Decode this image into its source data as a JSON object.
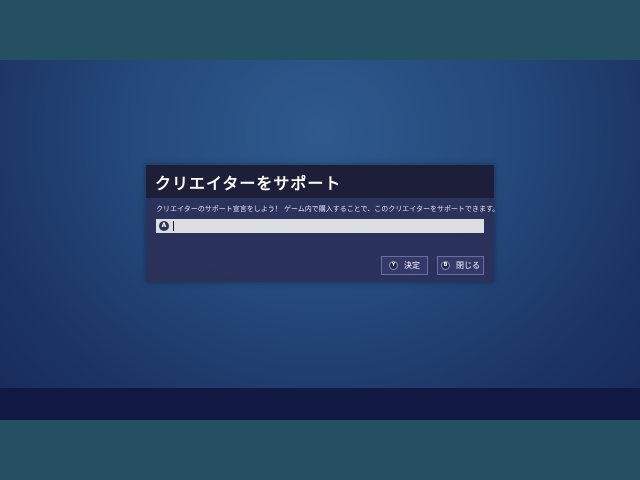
{
  "dialog": {
    "title": "クリエイターをサポート",
    "message": "クリエイターのサポート宣言をしよう！ ゲーム内で購入することで、このクリエイターをサポートできます。",
    "input": {
      "badge": "A",
      "value": "",
      "placeholder": ""
    },
    "buttons": {
      "confirm": {
        "badge": "Y",
        "label": "決定"
      },
      "close": {
        "badge": "B",
        "label": "閉じる"
      }
    }
  },
  "colors": {
    "letterbox": "#245062",
    "background_center": "#2f5a8e",
    "background_edge": "#172a58",
    "bottom_bar": "#111842",
    "dialog_body": "#2b3058",
    "dialog_header": "#1d1f38",
    "input_field": "#dcdde3",
    "button": "#34396a"
  }
}
